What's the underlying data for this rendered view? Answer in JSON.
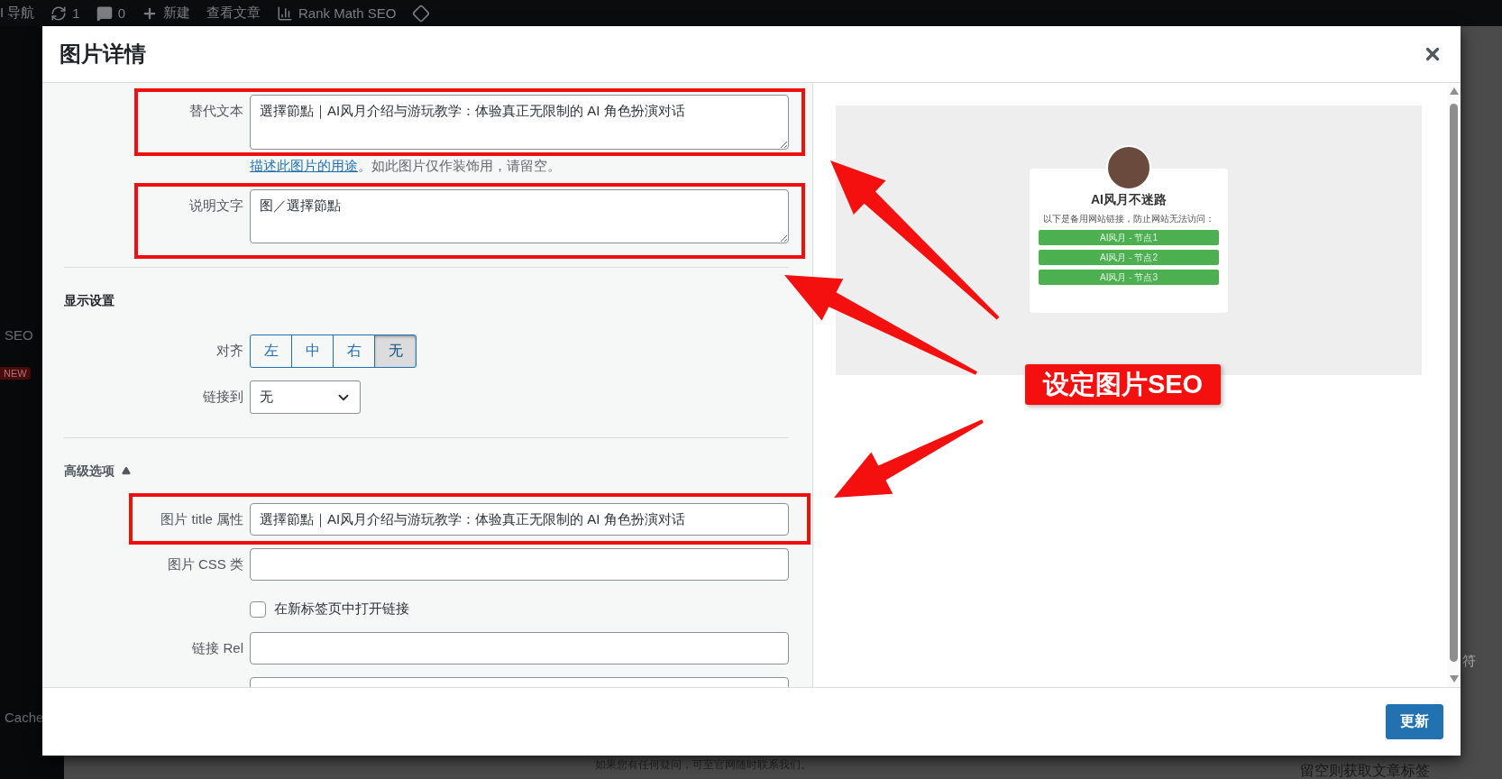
{
  "admin_bar": {
    "items": [
      {
        "kind": "text",
        "label": "I 导航"
      },
      {
        "kind": "updates",
        "label": "1"
      },
      {
        "kind": "comments",
        "label": "0"
      },
      {
        "kind": "new",
        "label": "新建"
      },
      {
        "kind": "text",
        "label": "查看文章"
      },
      {
        "kind": "rankmath",
        "label": "Rank Math SEO"
      },
      {
        "kind": "diamond"
      }
    ]
  },
  "background": {
    "sidebar_items": [
      {
        "kind": "text",
        "label": "SEO"
      },
      {
        "kind": "badge",
        "label": "NEW"
      },
      {
        "kind": "text",
        "label": "Cache"
      }
    ],
    "right_texts": [
      "符",
      "留空则获取文章标签"
    ],
    "footer_note": "如果您有任何疑问，可至官网随时联系我们。"
  },
  "dialog": {
    "title": "图片详情",
    "alt_text": {
      "label": "替代文本",
      "value": "選擇節點｜AI风月介绍与游玩教学：体验真正无限制的 AI 角色扮演对话",
      "highlighted": true
    },
    "alt_help": {
      "link": "描述此图片的用途",
      "text": "。如此图片仅作装饰用，请留空。"
    },
    "caption": {
      "label": "说明文字",
      "value": "图／選擇節點",
      "highlighted": true
    },
    "display_settings": {
      "heading": "显示设置",
      "align": {
        "label": "对齐",
        "options": [
          {
            "label": "左",
            "selected": false
          },
          {
            "label": "中",
            "selected": false
          },
          {
            "label": "右",
            "selected": false
          },
          {
            "label": "无",
            "selected": true
          }
        ]
      },
      "link_to": {
        "label": "链接到",
        "value": "无"
      }
    },
    "advanced": {
      "heading": "高级选项",
      "expanded": true,
      "fields": [
        {
          "kind": "input",
          "label": "图片 title 属性",
          "value": "選擇節點｜AI风月介绍与游玩教学：体验真正无限制的 AI 角色扮演对话",
          "highlighted": true
        },
        {
          "kind": "input",
          "label": "图片 CSS 类",
          "highlighted": false
        },
        {
          "kind": "checkbox",
          "label": "在新标签页中打开链接",
          "checked": false
        },
        {
          "kind": "input",
          "label": "链接 Rel",
          "highlighted": false
        },
        {
          "kind": "input",
          "highlighted": false
        }
      ]
    },
    "preview": {
      "title": "AI风月不迷路",
      "subtitle": "以下是备用网站链接，防止网站无法访问：",
      "buttons": [
        "AI风月 - 节点1",
        "AI风月 - 节点2",
        "AI风月 - 节点3"
      ]
    },
    "update_button": "更新"
  },
  "annotation": {
    "label": "设定图片SEO"
  }
}
